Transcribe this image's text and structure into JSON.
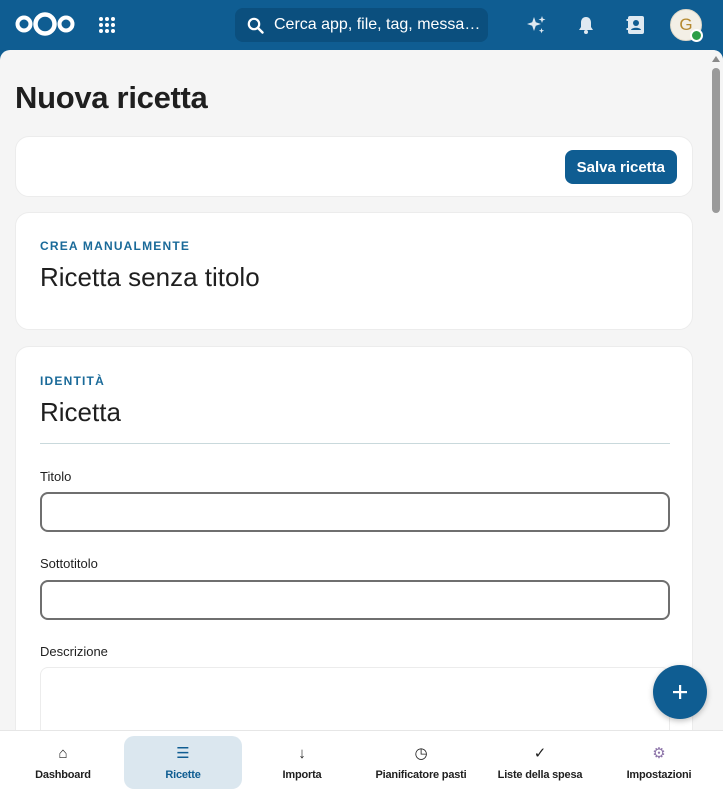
{
  "header": {
    "logo_icon": "nextcloud-logo-icon",
    "apps_icon": "apps-grid-icon",
    "search_placeholder": "Cerca app, file, tag, messagg…",
    "assistant_icon": "sparkle-icon",
    "notifications_icon": "bell-icon",
    "contacts_icon": "contacts-icon",
    "avatar_initial": "G",
    "status_color": "#2d9f48"
  },
  "page": {
    "title": "Nuova ricetta"
  },
  "actions": {
    "save_label": "Salva ricetta"
  },
  "mode_card": {
    "eyebrow": "CREA MANUALMENTE",
    "title": "Ricetta senza titolo"
  },
  "identity_card": {
    "eyebrow": "IDENTITÀ",
    "title": "Ricetta",
    "fields": {
      "title_label": "Titolo",
      "title_value": "",
      "subtitle_label": "Sottotitolo",
      "subtitle_value": "",
      "description_label": "Descrizione",
      "description_value": ""
    }
  },
  "fab": {
    "label": "+",
    "icon": "plus-icon"
  },
  "bottom_nav": {
    "items": [
      {
        "label": "Dashboard",
        "icon": "⌂"
      },
      {
        "label": "Ricette",
        "icon": "☰",
        "active": true
      },
      {
        "label": "Importa",
        "icon": "↓"
      },
      {
        "label": "Pianificatore pasti",
        "icon": "◷"
      },
      {
        "label": "Liste della spesa",
        "icon": "✓"
      },
      {
        "label": "Impostazioni",
        "icon": "⚙"
      }
    ]
  },
  "colors": {
    "brand": "#0f5d92",
    "accent_text": "#1a6a99",
    "nav_active_bg": "#dbe7ef"
  }
}
